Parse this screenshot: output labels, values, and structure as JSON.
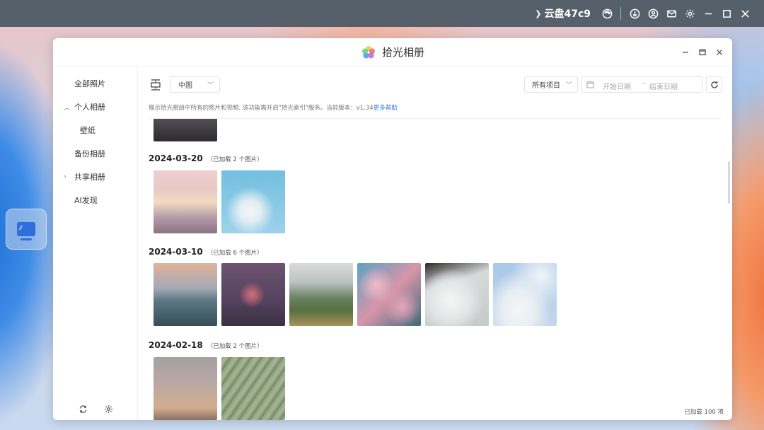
{
  "system_bar": {
    "account": "云盘47c9",
    "icons": [
      "chevron-down-icon",
      "palette-icon",
      "update-icon",
      "user-icon",
      "mail-icon",
      "gear-icon",
      "minimize-icon",
      "maximize-icon",
      "close-icon"
    ]
  },
  "window": {
    "title": "拾光相册"
  },
  "sidebar": {
    "items": [
      {
        "label": "全部照片",
        "expandable": false,
        "level": 0
      },
      {
        "label": "个人相册",
        "expandable": true,
        "level": 0
      },
      {
        "label": "壁纸",
        "expandable": false,
        "level": 1
      },
      {
        "label": "备份相册",
        "expandable": false,
        "level": 0
      },
      {
        "label": "共享相册",
        "expandable": true,
        "level": 0
      },
      {
        "label": "AI发现",
        "expandable": false,
        "level": 0
      }
    ]
  },
  "toolbar": {
    "size_select": "中图",
    "filter_select": "所有项目",
    "date_start_placeholder": "开始日期",
    "date_separator": "-",
    "date_end_placeholder": "结束日期"
  },
  "hint": {
    "text": "展示拾光相册中所有的图片和视频, 该功能需开启\"拾光索引\"服务。当前版本：v1.34",
    "link": "更多帮助"
  },
  "groups": [
    {
      "date": "2024-03-20",
      "count": "（已加载 2 个图片）"
    },
    {
      "date": "2024-03-10",
      "count": "（已加载 6 个图片）"
    },
    {
      "date": "2024-02-18",
      "count": "（已加载 2 个图片）"
    }
  ],
  "footer": {
    "loaded": "已加载 100 项"
  },
  "colors": {
    "accent": "#2f7ae5",
    "system_bar": "#55606b"
  }
}
